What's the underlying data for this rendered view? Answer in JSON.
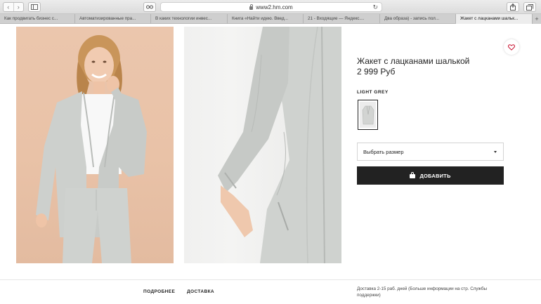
{
  "browser": {
    "back_glyph": "‹",
    "forward_glyph": "›",
    "address": "www2.hm.com",
    "reload_glyph": "↻",
    "tabs": [
      {
        "label": "Как продвигать бизнес с...",
        "active": false
      },
      {
        "label": "Автоматизированные пра...",
        "active": false
      },
      {
        "label": "В каких технологии инвес...",
        "active": false
      },
      {
        "label": "Книга «Найти идею. Введ...",
        "active": false
      },
      {
        "label": "21 - Входящие — Яндекс....",
        "active": false
      },
      {
        "label": "Два образа) - запись пол...",
        "active": false
      },
      {
        "label": "Жакет с лацканами шальк...",
        "active": true
      }
    ],
    "new_tab_glyph": "+"
  },
  "product": {
    "title": "Жакет с лацканами шалькой",
    "price": "2 999 Руб",
    "color_name": "LIGHT GREY",
    "size_select_label": "Выбрать размер",
    "add_button_label": "ДОБАВИТЬ"
  },
  "footer": {
    "details_tab": "ПОДРОБНЕЕ",
    "delivery_tab": "ДОСТАВКА",
    "delivery_text": "Доставка 2-15 раб. дней (Больше информации на стр. Службы поддержки)"
  },
  "colors": {
    "accent": "#222222",
    "heart": "#c8102e",
    "jacket": "#cdd0cd",
    "photo_bg": "#ebc6ad"
  },
  "icons": [
    "back-icon",
    "forward-icon",
    "sidebar-icon",
    "reader-icon",
    "lock-icon",
    "reload-icon",
    "share-icon",
    "tabs-icon",
    "heart-icon",
    "bag-icon",
    "chevron-down-icon"
  ]
}
